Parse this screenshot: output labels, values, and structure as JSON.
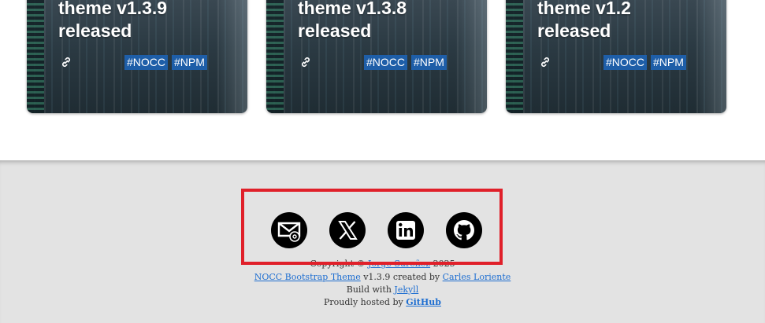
{
  "cards": [
    {
      "title_line1": "theme v1.3.9",
      "title_line2": "released",
      "tags": [
        "#NOCC",
        "#NPM"
      ]
    },
    {
      "title_line1": "theme v1.3.8",
      "title_line2": "released",
      "tags": [
        "#NOCC",
        "#NPM"
      ]
    },
    {
      "title_line1": "theme v1.2",
      "title_line2": "released",
      "tags": [
        "#NOCC",
        "#NPM"
      ]
    }
  ],
  "footer": {
    "social_icons": [
      "mail-icon",
      "x-icon",
      "linkedin-icon",
      "github-icon"
    ],
    "copyright_prefix": "Copyright ©",
    "copyright_name": "Jorge Sureñez",
    "copyright_year": "2025",
    "theme_link": "NOCC Bootstrap Theme",
    "theme_version_text": "v1.3.9 created by",
    "theme_author": "Carles Loriente",
    "build_prefix": "Build with",
    "build_link": "Jekyll",
    "hosted_prefix": "Proudly hosted by",
    "hosted_link": "GitHub"
  },
  "colors": {
    "tag_bg": "#1e5ea8",
    "footer_bg": "#e3e3e3",
    "highlight": "#e0202a",
    "link": "#1f6fd1"
  }
}
